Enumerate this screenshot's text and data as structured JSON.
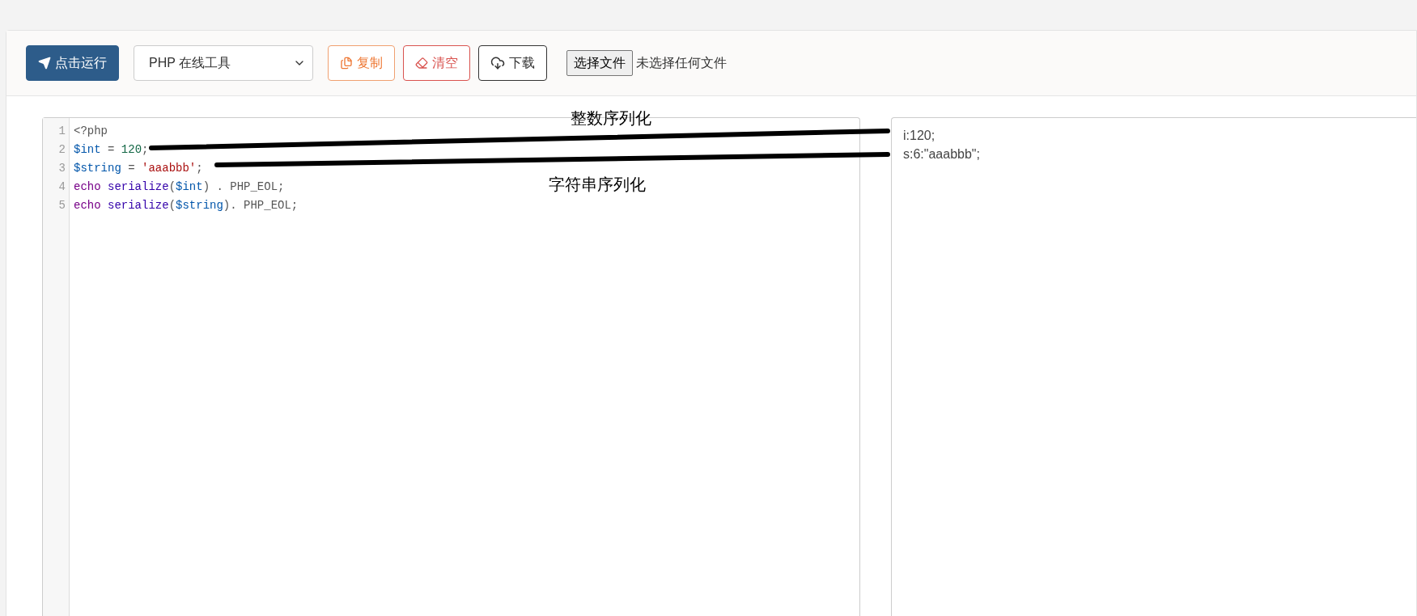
{
  "toolbar": {
    "run_button": "点击运行",
    "language_select": "PHP 在线工具",
    "copy_button": "复制",
    "clear_button": "清空",
    "download_button": "下载",
    "file_button": "选择文件",
    "file_status": "未选择任何文件"
  },
  "editor": {
    "lines": [
      {
        "number": "1",
        "tokens": [
          {
            "kind": "meta",
            "text": "<?php"
          }
        ]
      },
      {
        "number": "2",
        "tokens": [
          {
            "kind": "variable",
            "text": "$int"
          },
          {
            "kind": "plain",
            "text": " = "
          },
          {
            "kind": "number",
            "text": "120"
          },
          {
            "kind": "plain",
            "text": ";"
          }
        ]
      },
      {
        "number": "3",
        "tokens": [
          {
            "kind": "variable",
            "text": "$string"
          },
          {
            "kind": "plain",
            "text": " = "
          },
          {
            "kind": "string",
            "text": "'aaabbb'"
          },
          {
            "kind": "plain",
            "text": ";"
          }
        ]
      },
      {
        "number": "4",
        "tokens": [
          {
            "kind": "keyword",
            "text": "echo"
          },
          {
            "kind": "builtin",
            "text": " serialize"
          },
          {
            "kind": "plain",
            "text": "("
          },
          {
            "kind": "variable",
            "text": "$int"
          },
          {
            "kind": "plain",
            "text": ") . PHP_EOL;"
          }
        ]
      },
      {
        "number": "5",
        "tokens": [
          {
            "kind": "keyword",
            "text": "echo"
          },
          {
            "kind": "builtin",
            "text": " serialize"
          },
          {
            "kind": "plain",
            "text": "("
          },
          {
            "kind": "variable",
            "text": "$string"
          },
          {
            "kind": "plain",
            "text": "). PHP_EOL;"
          }
        ]
      }
    ]
  },
  "output": {
    "lines": [
      "i:120;",
      "s:6:\"aaabbb\";"
    ]
  },
  "annotations": [
    {
      "label": "整数序列化"
    },
    {
      "label": "字符串序列化"
    }
  ]
}
